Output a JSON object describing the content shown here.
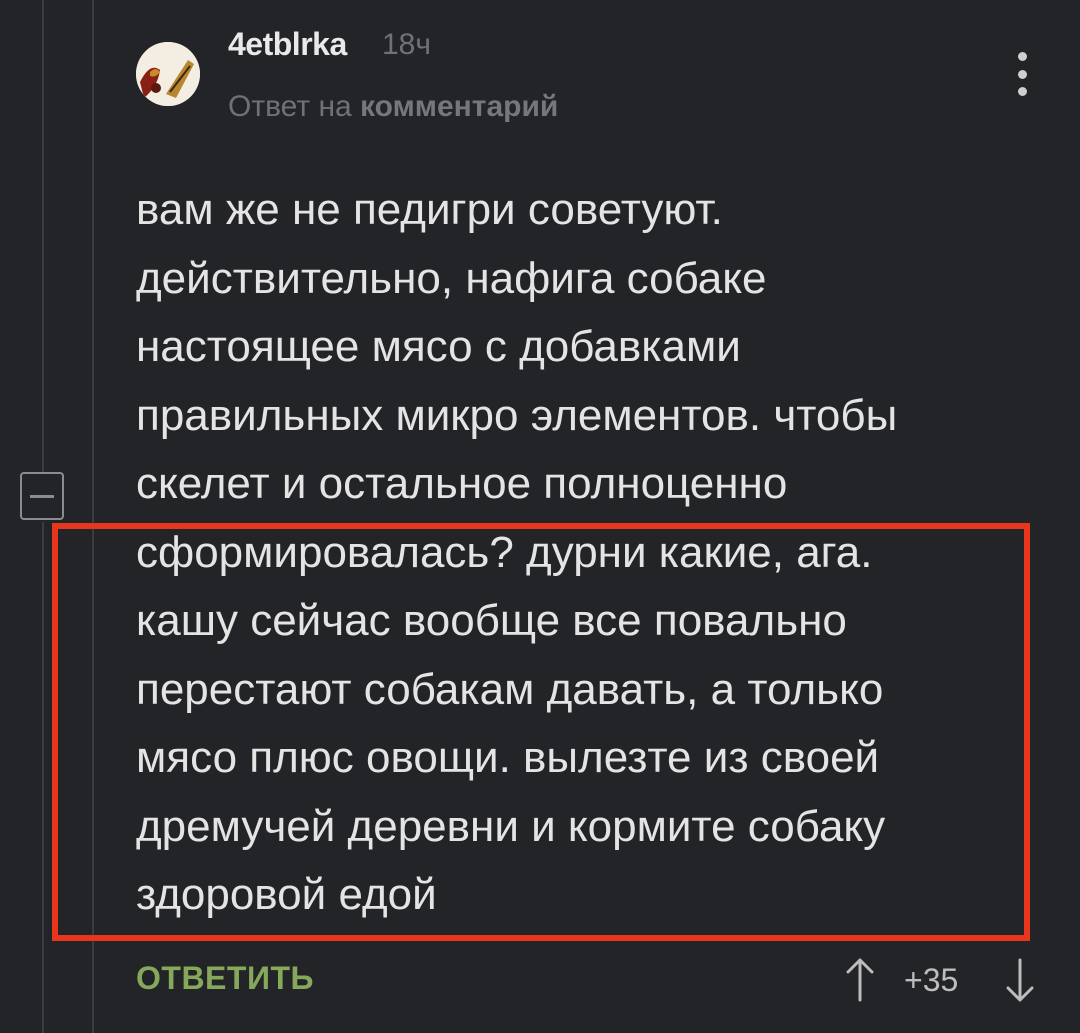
{
  "comment": {
    "author": "4etblrka",
    "time": "18ч",
    "reply_prefix": "Ответ на",
    "reply_target": "комментарий",
    "lines": [
      "вам же не педигри советуют.",
      "действительно, нафига собаке",
      "настоящее мясо с добавками",
      "правильных микро элементов. чтобы",
      "скелет и остальное полноценно",
      "сформировалась? дурни какие, ага.",
      "кашу сейчас вообще все повально",
      "перестают собакам давать, а только",
      "мясо плюс овощи. вылезте из своей",
      "дремучей деревни и кормите собаку",
      "здоровой едой"
    ]
  },
  "actions": {
    "reply_label": "ОТВЕТИТЬ",
    "score": "+35"
  },
  "icons": {
    "upvote": "arrow-up-icon",
    "downvote": "arrow-down-icon",
    "more": "more-vertical-icon",
    "collapse": "minus-icon"
  },
  "colors": {
    "background": "#232427",
    "reply_green": "#86a85a",
    "highlight_red": "#e8361e",
    "muted": "#6f7175"
  }
}
